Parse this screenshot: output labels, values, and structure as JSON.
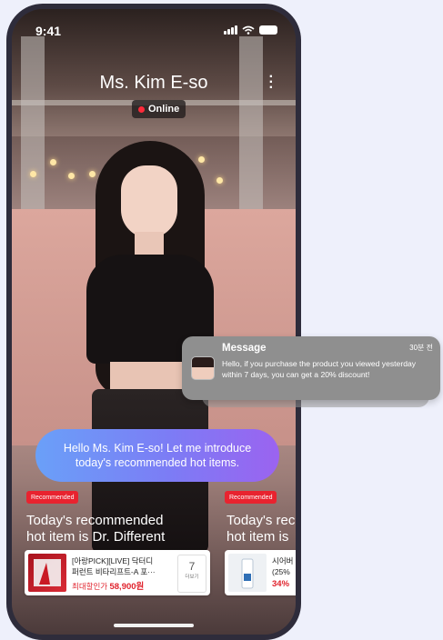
{
  "status_bar": {
    "time": "9:41"
  },
  "header": {
    "name": "Ms. Kim E-so",
    "status": "Online"
  },
  "chat_bubble": {
    "text": "Hello Ms. Kim E-so! Let me introduce today's recommended hot items."
  },
  "recommendations": [
    {
      "badge": "Recommended",
      "title_line1": "Today's recommended",
      "title_line2": "hot item is Dr. Different",
      "product": {
        "name_line1": "[아랑PICK][LIVE] 닥터디",
        "name_line2": "퍼런트 비타리프트-A 포···",
        "price_label": "최대할인가",
        "price": "58,900원",
        "more_count": "7",
        "more_label": "더보기"
      }
    },
    {
      "badge": "Recommended",
      "title_line1": "Today's rec",
      "title_line2": "hot item is",
      "product": {
        "name_line1": "시어버",
        "name_line2": "(25%",
        "price": "34%"
      }
    }
  ],
  "notification": {
    "title": "Message",
    "time": "30분 전",
    "body": "Hello, if you purchase the product you viewed yesterday within 7 days, you can get a 20% discount!"
  },
  "colors": {
    "accent_red": "#e8232f",
    "bubble_start": "#6aa0f8",
    "bubble_end": "#9b63f0"
  }
}
